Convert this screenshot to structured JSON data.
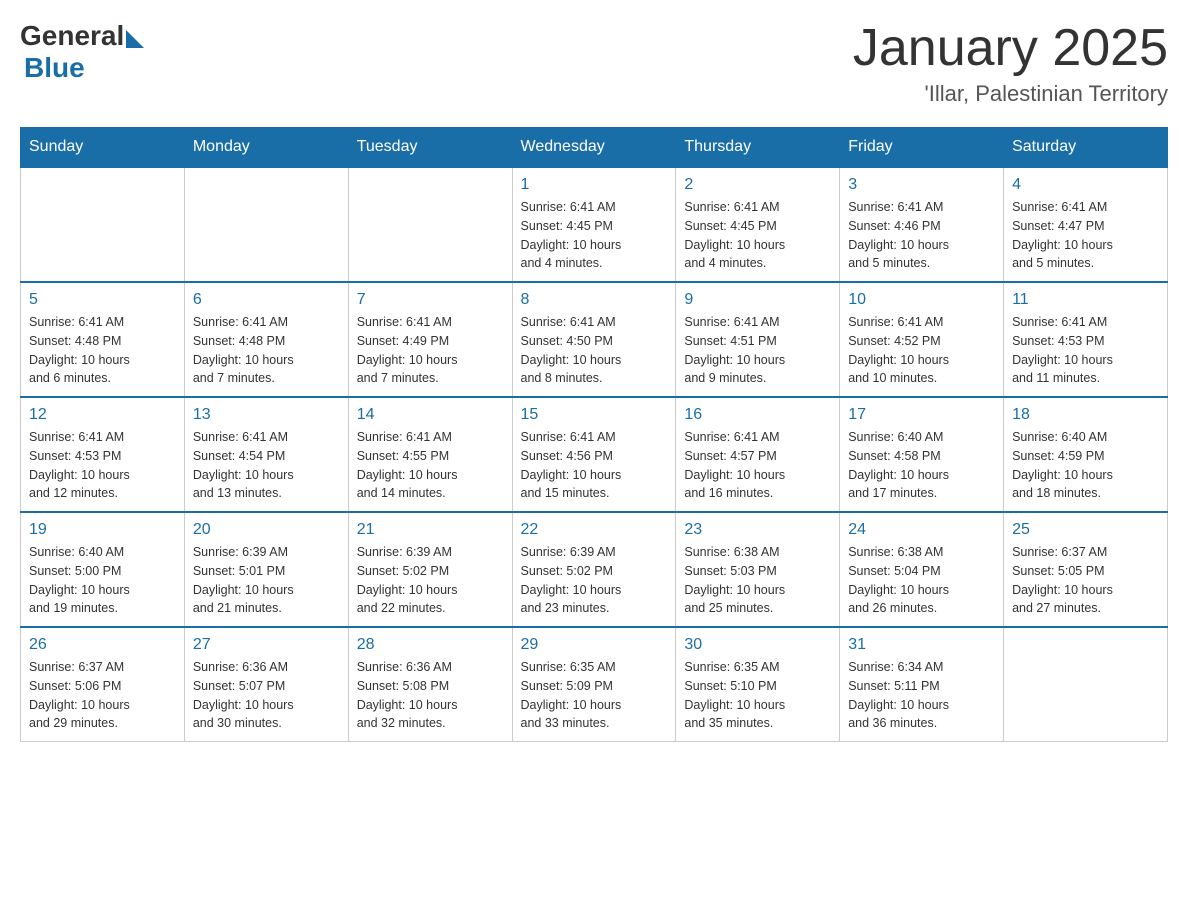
{
  "header": {
    "logo_general": "General",
    "logo_blue": "Blue",
    "month_title": "January 2025",
    "location": "'Illar, Palestinian Territory"
  },
  "days_of_week": [
    "Sunday",
    "Monday",
    "Tuesday",
    "Wednesday",
    "Thursday",
    "Friday",
    "Saturday"
  ],
  "weeks": [
    [
      {
        "day": "",
        "info": ""
      },
      {
        "day": "",
        "info": ""
      },
      {
        "day": "",
        "info": ""
      },
      {
        "day": "1",
        "info": "Sunrise: 6:41 AM\nSunset: 4:45 PM\nDaylight: 10 hours\nand 4 minutes."
      },
      {
        "day": "2",
        "info": "Sunrise: 6:41 AM\nSunset: 4:45 PM\nDaylight: 10 hours\nand 4 minutes."
      },
      {
        "day": "3",
        "info": "Sunrise: 6:41 AM\nSunset: 4:46 PM\nDaylight: 10 hours\nand 5 minutes."
      },
      {
        "day": "4",
        "info": "Sunrise: 6:41 AM\nSunset: 4:47 PM\nDaylight: 10 hours\nand 5 minutes."
      }
    ],
    [
      {
        "day": "5",
        "info": "Sunrise: 6:41 AM\nSunset: 4:48 PM\nDaylight: 10 hours\nand 6 minutes."
      },
      {
        "day": "6",
        "info": "Sunrise: 6:41 AM\nSunset: 4:48 PM\nDaylight: 10 hours\nand 7 minutes."
      },
      {
        "day": "7",
        "info": "Sunrise: 6:41 AM\nSunset: 4:49 PM\nDaylight: 10 hours\nand 7 minutes."
      },
      {
        "day": "8",
        "info": "Sunrise: 6:41 AM\nSunset: 4:50 PM\nDaylight: 10 hours\nand 8 minutes."
      },
      {
        "day": "9",
        "info": "Sunrise: 6:41 AM\nSunset: 4:51 PM\nDaylight: 10 hours\nand 9 minutes."
      },
      {
        "day": "10",
        "info": "Sunrise: 6:41 AM\nSunset: 4:52 PM\nDaylight: 10 hours\nand 10 minutes."
      },
      {
        "day": "11",
        "info": "Sunrise: 6:41 AM\nSunset: 4:53 PM\nDaylight: 10 hours\nand 11 minutes."
      }
    ],
    [
      {
        "day": "12",
        "info": "Sunrise: 6:41 AM\nSunset: 4:53 PM\nDaylight: 10 hours\nand 12 minutes."
      },
      {
        "day": "13",
        "info": "Sunrise: 6:41 AM\nSunset: 4:54 PM\nDaylight: 10 hours\nand 13 minutes."
      },
      {
        "day": "14",
        "info": "Sunrise: 6:41 AM\nSunset: 4:55 PM\nDaylight: 10 hours\nand 14 minutes."
      },
      {
        "day": "15",
        "info": "Sunrise: 6:41 AM\nSunset: 4:56 PM\nDaylight: 10 hours\nand 15 minutes."
      },
      {
        "day": "16",
        "info": "Sunrise: 6:41 AM\nSunset: 4:57 PM\nDaylight: 10 hours\nand 16 minutes."
      },
      {
        "day": "17",
        "info": "Sunrise: 6:40 AM\nSunset: 4:58 PM\nDaylight: 10 hours\nand 17 minutes."
      },
      {
        "day": "18",
        "info": "Sunrise: 6:40 AM\nSunset: 4:59 PM\nDaylight: 10 hours\nand 18 minutes."
      }
    ],
    [
      {
        "day": "19",
        "info": "Sunrise: 6:40 AM\nSunset: 5:00 PM\nDaylight: 10 hours\nand 19 minutes."
      },
      {
        "day": "20",
        "info": "Sunrise: 6:39 AM\nSunset: 5:01 PM\nDaylight: 10 hours\nand 21 minutes."
      },
      {
        "day": "21",
        "info": "Sunrise: 6:39 AM\nSunset: 5:02 PM\nDaylight: 10 hours\nand 22 minutes."
      },
      {
        "day": "22",
        "info": "Sunrise: 6:39 AM\nSunset: 5:02 PM\nDaylight: 10 hours\nand 23 minutes."
      },
      {
        "day": "23",
        "info": "Sunrise: 6:38 AM\nSunset: 5:03 PM\nDaylight: 10 hours\nand 25 minutes."
      },
      {
        "day": "24",
        "info": "Sunrise: 6:38 AM\nSunset: 5:04 PM\nDaylight: 10 hours\nand 26 minutes."
      },
      {
        "day": "25",
        "info": "Sunrise: 6:37 AM\nSunset: 5:05 PM\nDaylight: 10 hours\nand 27 minutes."
      }
    ],
    [
      {
        "day": "26",
        "info": "Sunrise: 6:37 AM\nSunset: 5:06 PM\nDaylight: 10 hours\nand 29 minutes."
      },
      {
        "day": "27",
        "info": "Sunrise: 6:36 AM\nSunset: 5:07 PM\nDaylight: 10 hours\nand 30 minutes."
      },
      {
        "day": "28",
        "info": "Sunrise: 6:36 AM\nSunset: 5:08 PM\nDaylight: 10 hours\nand 32 minutes."
      },
      {
        "day": "29",
        "info": "Sunrise: 6:35 AM\nSunset: 5:09 PM\nDaylight: 10 hours\nand 33 minutes."
      },
      {
        "day": "30",
        "info": "Sunrise: 6:35 AM\nSunset: 5:10 PM\nDaylight: 10 hours\nand 35 minutes."
      },
      {
        "day": "31",
        "info": "Sunrise: 6:34 AM\nSunset: 5:11 PM\nDaylight: 10 hours\nand 36 minutes."
      },
      {
        "day": "",
        "info": ""
      }
    ]
  ]
}
